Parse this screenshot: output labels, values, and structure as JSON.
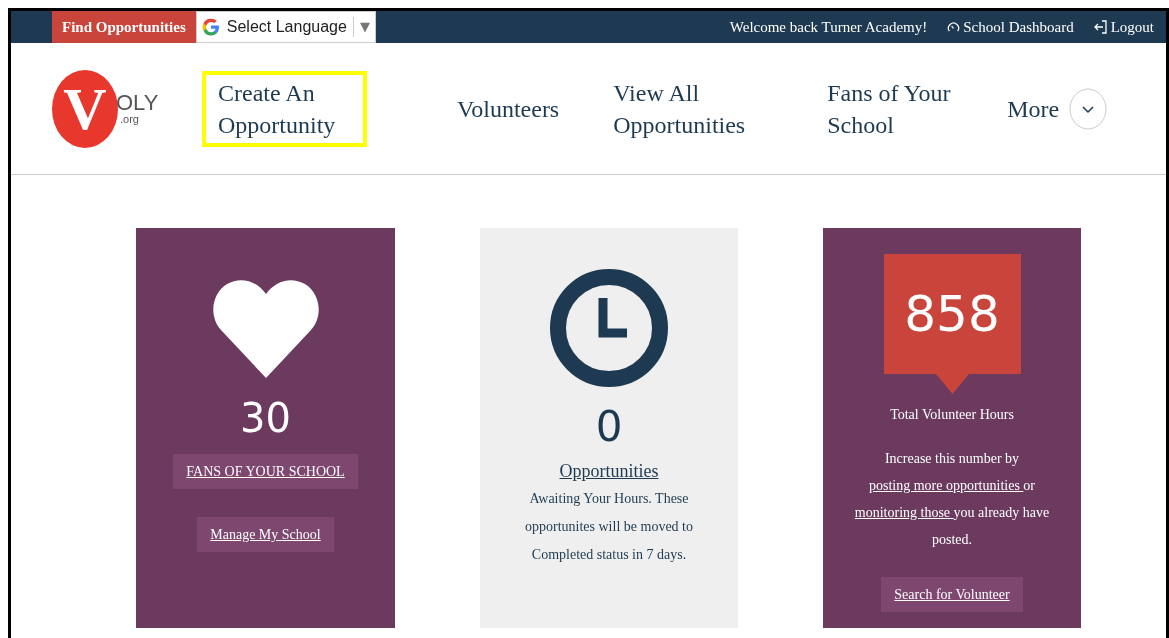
{
  "top_bar": {
    "find_button": "Find Opportunities",
    "language_select": {
      "label": "Select Language",
      "arrow": "▼"
    },
    "welcome": "Welcome back Turner Academy!",
    "links": [
      {
        "kind": "dashboard",
        "label": "School Dashboard"
      },
      {
        "kind": "logout",
        "label": "Logout"
      }
    ]
  },
  "logo": {
    "letter": "V",
    "text": "OLY",
    "domain": ".org"
  },
  "nav": {
    "items": [
      {
        "label": "Create An Opportunity",
        "highlighted": true
      },
      {
        "label": "Volunteers",
        "highlighted": false
      },
      {
        "label": "View All Opportunities",
        "highlighted": false
      },
      {
        "label": "Fans of Your School",
        "highlighted": false
      }
    ],
    "more": "More"
  },
  "cards": [
    {
      "kind": "fans",
      "value": "30",
      "buttons": [
        "FANS OF YOUR SCHOOL",
        "Manage My School"
      ]
    },
    {
      "kind": "opportunities",
      "value": "0",
      "link": "Opportunities",
      "text": "Awaiting Your Hours. These opportunites will be moved to Completed status in 7 days."
    },
    {
      "kind": "hours",
      "value": "858",
      "caption": "Total Volunteer Hours",
      "segments": [
        {
          "kind": "text",
          "text": "Increase this number by"
        },
        {
          "kind": "link",
          "text": "posting more opportunities"
        },
        {
          "kind": "text",
          "text": "or"
        },
        {
          "kind": "link",
          "text": "monitoring those"
        },
        {
          "kind": "text",
          "text": "you already have posted."
        }
      ],
      "button": "Search for Volunteer"
    }
  ]
}
